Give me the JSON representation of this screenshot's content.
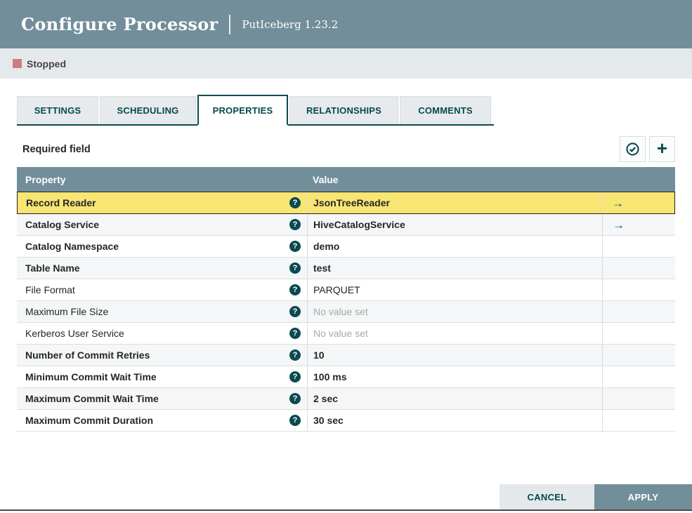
{
  "header": {
    "title": "Configure Processor",
    "subtitle": "PutIceberg 1.23.2"
  },
  "status": {
    "label": "Stopped"
  },
  "tabs": [
    {
      "label": "SETTINGS",
      "active": false
    },
    {
      "label": "SCHEDULING",
      "active": false
    },
    {
      "label": "PROPERTIES",
      "active": true
    },
    {
      "label": "RELATIONSHIPS",
      "active": false
    },
    {
      "label": "COMMENTS",
      "active": false
    }
  ],
  "toolbar": {
    "required_label": "Required field"
  },
  "icons": {
    "help": "?",
    "goto": "→",
    "plus": "+"
  },
  "table": {
    "columns": {
      "property": "Property",
      "value": "Value"
    },
    "rows": [
      {
        "property": "Record Reader",
        "value": "JsonTreeReader",
        "required": true,
        "value_set": true,
        "selected": true,
        "goto": true
      },
      {
        "property": "Catalog Service",
        "value": "HiveCatalogService",
        "required": true,
        "value_set": true,
        "selected": false,
        "goto": true
      },
      {
        "property": "Catalog Namespace",
        "value": "demo",
        "required": true,
        "value_set": true,
        "selected": false,
        "goto": false
      },
      {
        "property": "Table Name",
        "value": "test",
        "required": true,
        "value_set": true,
        "selected": false,
        "goto": false
      },
      {
        "property": "File Format",
        "value": "PARQUET",
        "required": false,
        "value_set": true,
        "selected": false,
        "goto": false
      },
      {
        "property": "Maximum File Size",
        "value": "No value set",
        "required": false,
        "value_set": false,
        "selected": false,
        "goto": false
      },
      {
        "property": "Kerberos User Service",
        "value": "No value set",
        "required": false,
        "value_set": false,
        "selected": false,
        "goto": false
      },
      {
        "property": "Number of Commit Retries",
        "value": "10",
        "required": true,
        "value_set": true,
        "selected": false,
        "goto": false
      },
      {
        "property": "Minimum Commit Wait Time",
        "value": "100 ms",
        "required": true,
        "value_set": true,
        "selected": false,
        "goto": false
      },
      {
        "property": "Maximum Commit Wait Time",
        "value": "2 sec",
        "required": true,
        "value_set": true,
        "selected": false,
        "goto": false
      },
      {
        "property": "Maximum Commit Duration",
        "value": "30 sec",
        "required": true,
        "value_set": true,
        "selected": false,
        "goto": false
      }
    ]
  },
  "footer": {
    "cancel_label": "CANCEL",
    "apply_label": "APPLY"
  },
  "colors": {
    "accent_teal": "#0B4A4F",
    "header_slate": "#728E9B",
    "status_bar_bg": "#E4E9EC",
    "stopped_swatch": "#CA7E81",
    "selected_row": "#F8E573",
    "row_alt": "#F4F6F7",
    "unset_text": "#A8A8A8"
  }
}
